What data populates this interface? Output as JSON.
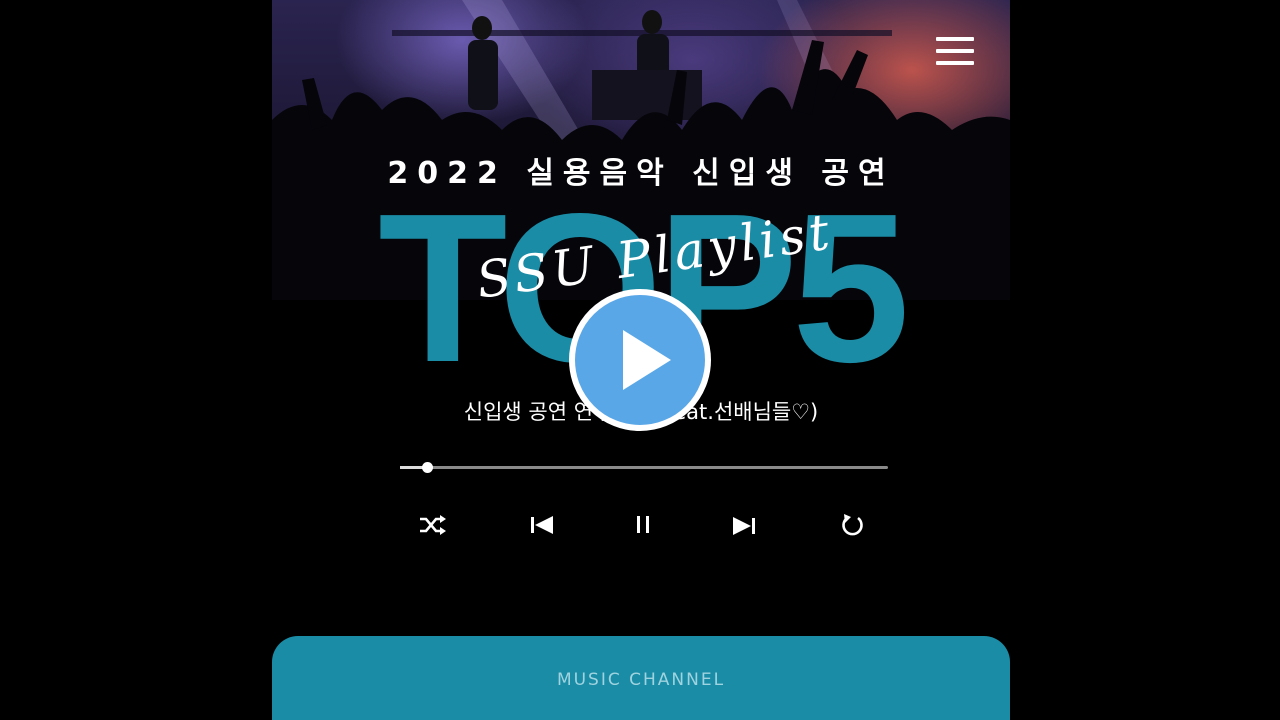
{
  "poster": {
    "subtitle": "2022 실용음악 신입생 공연",
    "headline": "TOP5",
    "script_title": "SSU Playlist",
    "song_title": "신입생 공연 연주영상 (feat.선배님들♡)"
  },
  "player": {
    "progress": 0.055,
    "controls": [
      "shuffle-icon",
      "previous-icon",
      "pause-icon",
      "next-icon",
      "repeat-icon"
    ]
  },
  "channel": {
    "label": "MUSIC CHANNEL"
  },
  "colors": {
    "accent": "#1a8ca6",
    "play_button": "#5aa7e8"
  }
}
